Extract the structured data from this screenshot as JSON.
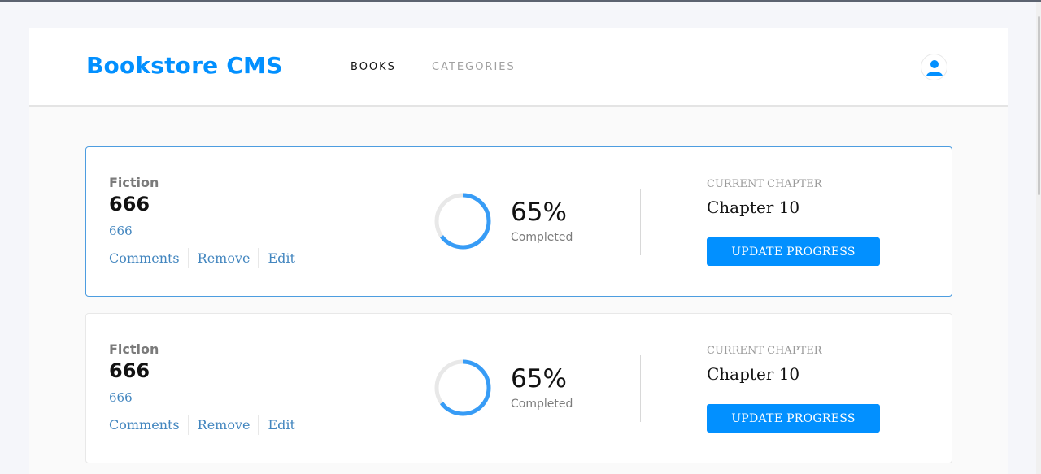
{
  "app": {
    "title": "Bookstore CMS"
  },
  "nav": [
    {
      "label": "BOOKS",
      "active": true
    },
    {
      "label": "CATEGORIES",
      "active": false
    }
  ],
  "user": {
    "icon": "user-icon"
  },
  "books": [
    {
      "category": "Fiction",
      "title": "666",
      "author": "666",
      "actions": {
        "comments": "Comments",
        "remove": "Remove",
        "edit": "Edit"
      },
      "progress": {
        "percent_text": "65%",
        "percent": 65,
        "completed_label": "Completed"
      },
      "chapter": {
        "label": "CURRENT CHAPTER",
        "value": "Chapter 10"
      },
      "button": "UPDATE PROGRESS"
    },
    {
      "category": "Fiction",
      "title": "666",
      "author": "666",
      "actions": {
        "comments": "Comments",
        "remove": "Remove",
        "edit": "Edit"
      },
      "progress": {
        "percent_text": "65%",
        "percent": 65,
        "completed_label": "Completed"
      },
      "chapter": {
        "label": "CURRENT CHAPTER",
        "value": "Chapter 10"
      },
      "button": "UPDATE PROGRESS"
    }
  ],
  "colors": {
    "accent": "#0290ff",
    "link": "#4386bf",
    "ring_progress": "#379cf6",
    "ring_track": "#e8e8e8"
  }
}
